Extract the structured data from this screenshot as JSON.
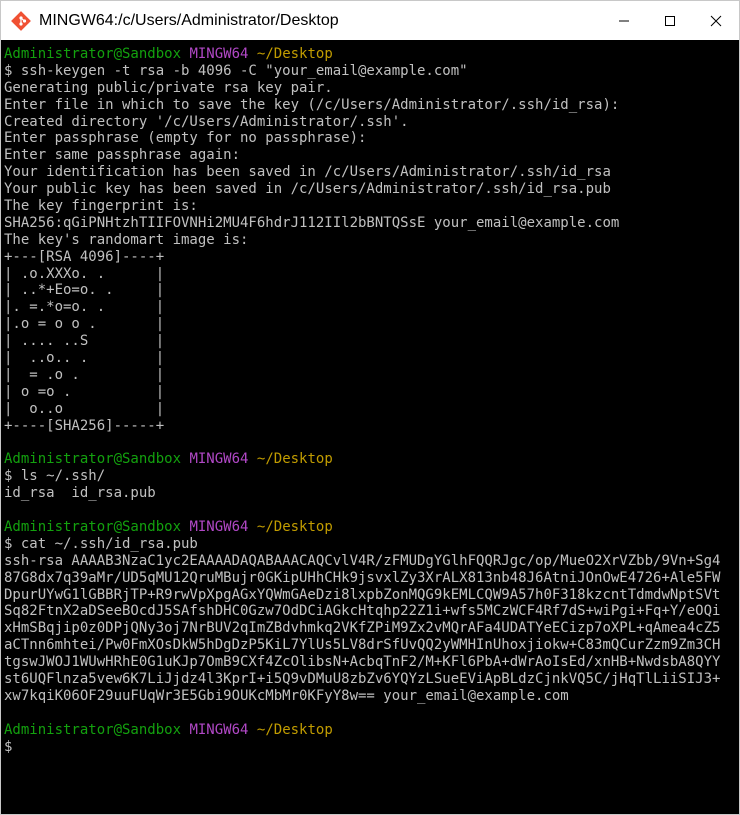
{
  "window": {
    "title": "MINGW64:/c/Users/Administrator/Desktop",
    "icons": {
      "app": "git-bash-icon",
      "minimize": "minimize-icon",
      "maximize": "maximize-icon",
      "close": "close-icon"
    }
  },
  "prompt": {
    "user_host": "Administrator@Sandbox",
    "system": "MINGW64",
    "path": "~/Desktop"
  },
  "blocks": [
    {
      "command": "$ ssh-keygen -t rsa -b 4096 -C \"your_email@example.com\"",
      "output": [
        "Generating public/private rsa key pair.",
        "Enter file in which to save the key (/c/Users/Administrator/.ssh/id_rsa):",
        "Created directory '/c/Users/Administrator/.ssh'.",
        "Enter passphrase (empty for no passphrase):",
        "Enter same passphrase again:",
        "Your identification has been saved in /c/Users/Administrator/.ssh/id_rsa",
        "Your public key has been saved in /c/Users/Administrator/.ssh/id_rsa.pub",
        "The key fingerprint is:",
        "SHA256:qGiPNHtzhTIIFOVNHi2MU4F6hdrJ112IIl2bBNTQSsE your_email@example.com",
        "The key's randomart image is:",
        "+---[RSA 4096]----+",
        "| .o.XXXo. .      |",
        "| ..*+Eo=o. .     |",
        "|. =.*o=o. .      |",
        "|.o = o o .       |",
        "| .... ..S        |",
        "|  ..o.. .        |",
        "|  = .o .         |",
        "| o =o .          |",
        "|  o..o           |",
        "+----[SHA256]-----+"
      ]
    },
    {
      "command": "$ ls ~/.ssh/",
      "output": [
        "id_rsa  id_rsa.pub"
      ]
    },
    {
      "command": "$ cat ~/.ssh/id_rsa.pub",
      "output": [
        "ssh-rsa AAAAB3NzaC1yc2EAAAADAQABAAACAQCvlV4R/zFMUDgYGlhFQQRJgc/op/MueO2XrVZbb/9Vn+Sg487G8dx7q39aMr/UD5qMU12QruMBujr0GKipUHhCHk9jsvxlZy3XrALX813nb48J6AtniJOnOwE4726+Ale5FWDpurUYwG1lGBBRjTP+R9rwVpXpgAGxYQWmGAeDzi8lxpbZonMQG9kEMLCQW9A57h0F318kzcntTdmdwNptSVtSq82FtnX2aDSeeBOcdJ5SAfshDHC0Gzw7OdDCiAGkcHtqhp22Z1i+wfs5MCzWCF4Rf7dS+wiPgi+Fq+Y/eOQixHmSBqjip0z0DPjQNy3oj7NrBUV2qImZBdvhmkq2VKfZPiM9Zx2vMQrAFa4UDATYeECizp7oXPL+qAmea4cZ5aCTnn6mhtei/Pw0FmXOsDkW5hDgDzP5KiL7YlUs5LV8drSfUvQQ2yWMHInUhoxjiokw+C83mQCurZzm9Zm3CHtgswJWOJ1WUwHRhE0G1uKJp7OmB9CXf4ZcOlibsN+AcbqTnF2/M+KFl6PbA+dWrAoIsEd/xnHB+NwdsbA8QYYst6UQFlnza5vew6K7LiJjdz4l3KprI+i5Q9vDMuU8zbZv6YQYzLSueEViApBLdzCjnkVQ5C/jHqTlLiiSIJ3+xw7kqiK06OF29uuFUqWr3E5Gbi9OUKcMbMr0KFyY8w== your_email@example.com"
      ]
    }
  ],
  "final_cursor": "$"
}
